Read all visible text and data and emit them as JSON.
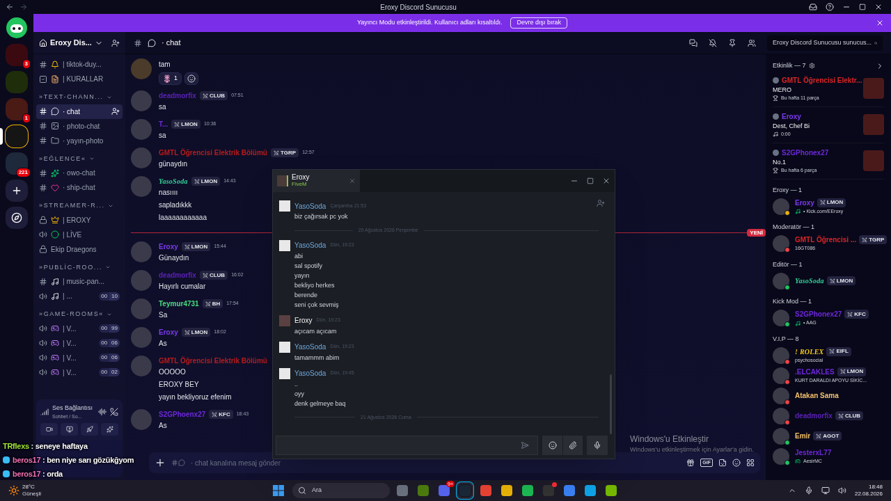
{
  "window": {
    "title": "Eroxy Discord Sunucusu"
  },
  "banner": {
    "text": "Yayıncı Modu etkinleştirildi. Kullanıcı adları kısaltıldı.",
    "button": "Devre dışı bırak"
  },
  "servers": [
    {
      "kind": "server",
      "selected": false,
      "badge": "3"
    },
    {
      "kind": "server",
      "selected": false
    },
    {
      "kind": "server",
      "selected": false,
      "badge": "1"
    },
    {
      "kind": "server",
      "selected": true
    },
    {
      "kind": "folder",
      "selected": false,
      "badge": "221"
    },
    {
      "kind": "add",
      "selected": false
    },
    {
      "kind": "discover",
      "selected": false
    }
  ],
  "server": {
    "name": "Eroxy Dis..."
  },
  "channels": [
    {
      "kind": "text",
      "name": "| tiktok-duy...",
      "selected": false
    },
    {
      "kind": "rules",
      "name": "| KURALLAR",
      "selected": false
    },
    {
      "kind": "category",
      "name": "»TEXT-CHANN..."
    },
    {
      "kind": "text",
      "name": "· chat",
      "selected": true
    },
    {
      "kind": "text",
      "name": "· photo-chat",
      "selected": false
    },
    {
      "kind": "text",
      "name": "· yayın-photo",
      "selected": false
    },
    {
      "kind": "category",
      "name": "»EĞLENCE«"
    },
    {
      "kind": "text",
      "name": "· owo-chat",
      "selected": false
    },
    {
      "kind": "text",
      "name": "· ship-chat",
      "selected": false
    },
    {
      "kind": "category",
      "name": "»STREAMER-R..."
    },
    {
      "kind": "locked",
      "name": "| EROXY",
      "selected": false
    },
    {
      "kind": "voice",
      "name": "| LİVE",
      "selected": false
    },
    {
      "kind": "locked",
      "name": "Ekip Draegons",
      "selected": false
    },
    {
      "kind": "category",
      "name": "»PUBLİC-ROO..."
    },
    {
      "kind": "text",
      "name": "| music-pan...",
      "selected": false
    },
    {
      "kind": "voice",
      "name": "| ...",
      "selected": false,
      "users": "00",
      "limit": "10"
    },
    {
      "kind": "category",
      "name": "»GAME-ROOMS«"
    },
    {
      "kind": "voice",
      "name": "| V...",
      "selected": false,
      "users": "00",
      "limit": "99"
    },
    {
      "kind": "voice",
      "name": "| V...",
      "selected": false,
      "users": "00",
      "limit": "06"
    },
    {
      "kind": "voice",
      "name": "| V...",
      "selected": false,
      "users": "00",
      "limit": "06"
    },
    {
      "kind": "voice",
      "name": "| V...",
      "selected": false,
      "users": "00",
      "limit": "02"
    }
  ],
  "voice": {
    "title": "Ses Bağlantısı",
    "subtitle": "Sohbet / So..."
  },
  "header": {
    "channel": "· chat",
    "search": "Eroxy Discord Sunucusu sunucus..."
  },
  "messages": [
    {
      "kind": "continuation",
      "lines": [
        "tam"
      ],
      "reactions": [
        {
          "count": "1"
        }
      ]
    },
    {
      "kind": "message",
      "author": "deadmorfix",
      "color": "#5b21b6",
      "decorated": false,
      "tag": "CLUB",
      "time": "07:51",
      "lines": [
        "sa"
      ]
    },
    {
      "kind": "message",
      "author": "T...",
      "color": "#6d28d9",
      "decorated": false,
      "tag": "LMON",
      "time": "10:36",
      "lines": [
        "sa"
      ]
    },
    {
      "kind": "message",
      "author": "GMTL Öğrencisi Elektrik Bölümü",
      "color": "#b91c1c",
      "decorated": false,
      "tag": "TGRP",
      "time": "12:57",
      "lines": [
        "günaydın"
      ]
    },
    {
      "kind": "message",
      "author": "YasoSoda",
      "color": "#34d399",
      "decorated": true,
      "tag": "LMON",
      "time": "14:43",
      "lines": [
        "nasıııı",
        "sapladıkkk",
        "laaaaaaaaaaaa"
      ]
    },
    {
      "kind": "divider",
      "label": "YENİ"
    },
    {
      "kind": "message",
      "author": "Eroxy",
      "color": "#7c3aed",
      "decorated": false,
      "tag": "LMON",
      "time": "15:44",
      "lines": [
        "Günaydın"
      ]
    },
    {
      "kind": "message",
      "author": "deadmorfix",
      "color": "#5b21b6",
      "decorated": false,
      "tag": "CLUB",
      "time": "16:02",
      "lines": [
        "Hayırlı cumalar"
      ]
    },
    {
      "kind": "message",
      "author": "Teymur4731",
      "color": "#4ade80",
      "decorated": false,
      "tag": "BH",
      "time": "17:54",
      "lines": [
        "Sa"
      ]
    },
    {
      "kind": "message",
      "author": "Eroxy",
      "color": "#7c3aed",
      "decorated": false,
      "tag": "LMON",
      "time": "18:02",
      "lines": [
        "As"
      ]
    },
    {
      "kind": "message",
      "author": "GMTL Öğrencisi Elektrik Bölümü",
      "color": "#b91c1c",
      "decorated": false,
      "lines": [
        "OOOOO",
        "EROXY BEY",
        "yayın bekliyoruz efenim"
      ]
    },
    {
      "kind": "message",
      "author": "S2GPhoenx27",
      "color": "#6d28d9",
      "decorated": false,
      "tag": "KFC",
      "time": "18:43",
      "lines": [
        "As"
      ]
    }
  ],
  "composer": {
    "placeholder": "· chat kanalına mesaj gönder",
    "gif": "GIF"
  },
  "activity": {
    "title": "Etkinlik — 7",
    "cards": [
      {
        "name": "GMTL Öğrencisi Elektr...",
        "color": "#dc2626",
        "title": "MERO",
        "detail": "Bu hafta 11 parça",
        "kind": "trophy"
      },
      {
        "name": "Eroxy",
        "color": "#7c3aed",
        "title": "Dest, Chef Bi",
        "detail": "0:00",
        "kind": "music"
      },
      {
        "name": "S2GPhonex27",
        "color": "#6d28d9",
        "title": "No.1",
        "detail": "Bu hafta 6 parça",
        "kind": "trophy"
      }
    ]
  },
  "member_groups": [
    {
      "title": "Eroxy — 1",
      "members": [
        {
          "name": "Eroxy",
          "color": "#7c3aed",
          "decorated": false,
          "tag": "LMON",
          "activity": {
            "kind": "music",
            "text": "• Kick.com/EEroxy"
          },
          "status": {
            "color": "#eab308"
          }
        }
      ]
    },
    {
      "title": "Moderatör — 1",
      "members": [
        {
          "name": "GMTL Öğrencisi ...",
          "color": "#dc2626",
          "decorated": false,
          "tag": "TGRP",
          "activity": {
            "kind": "plain",
            "text": "16GT086"
          },
          "status": {
            "color": "#ef4444"
          }
        }
      ]
    },
    {
      "title": "Editör — 1",
      "members": [
        {
          "name": "YasoSoda",
          "color": "#34d399",
          "decorated": true,
          "tag": "LMON",
          "status": {
            "color": "#22c55e"
          }
        }
      ]
    },
    {
      "title": "Kick Mod — 1",
      "members": [
        {
          "name": "S2GPhonex27",
          "color": "#6d28d9",
          "decorated": false,
          "tag": "KFC",
          "activity": {
            "kind": "music",
            "text": "• AAG"
          },
          "status": {
            "color": "#22c55e"
          }
        }
      ]
    },
    {
      "title": "V.I.P — 8",
      "members": [
        {
          "name": "! ROLEX",
          "color": "#facc15",
          "decorated": true,
          "tag": "EIFL",
          "activity": {
            "kind": "plain",
            "text": "psychosocial"
          },
          "status": {
            "color": "#ef4444"
          }
        },
        {
          "name": ".ELCAKLES",
          "color": "#6d28d9",
          "decorated": false,
          "tag": "LMON",
          "activity": {
            "kind": "plain",
            "text": "KURT DARALDI APOYU SİKİC..."
          },
          "status": {
            "color": "#ef4444"
          }
        },
        {
          "name": "Atakan Sama",
          "color": "#f5c26b",
          "decorated": false,
          "status": {
            "color": "#ef4444"
          }
        },
        {
          "name": "deadmorfix",
          "color": "#5b21b6",
          "decorated": false,
          "tag": "CLUB",
          "status": {
            "color": "#ef4444"
          }
        },
        {
          "name": "Emir",
          "color": "#f5c26b",
          "decorated": false,
          "tag": "AGOT",
          "status": {
            "color": "#22c55e"
          }
        },
        {
          "name": "JesterxL77",
          "color": "#6d28d9",
          "decorated": false,
          "activity": {
            "kind": "game",
            "text": "AesirMC"
          },
          "status": {
            "color": "#22c55e"
          }
        }
      ]
    }
  ],
  "steam_chat": {
    "tab": {
      "name": "Eroxy",
      "status": "FiveM"
    },
    "messages": [
      {
        "kind": "message",
        "author": "YasoSoda",
        "self": false,
        "time": "Çarşamba 21:53",
        "lines": [
          "biz çağırsak pc yok"
        ]
      },
      {
        "kind": "date",
        "label": "20 Ağustos 2026 Perşembe"
      },
      {
        "kind": "message",
        "author": "YasoSoda",
        "self": false,
        "time": "Dün, 19:23",
        "lines": [
          "abi",
          "sal spotify",
          "yayın",
          "bekliyo herkes",
          "berende",
          "seni çok sevmiş"
        ]
      },
      {
        "kind": "message",
        "author": "Eroxy",
        "self": true,
        "time": "Dün, 19:23",
        "lines": [
          "açıcam açıcam"
        ]
      },
      {
        "kind": "message",
        "author": "YasoSoda",
        "self": false,
        "time": "Dün, 19:23",
        "lines": [
          "tamammm abim"
        ]
      },
      {
        "kind": "message",
        "author": "YasoSoda",
        "self": false,
        "time": "Dün, 19:45",
        "lines": [
          "..",
          "oyy",
          "denk gelmeye baq"
        ]
      },
      {
        "kind": "date",
        "label": "21 Ağustos 2026 Cuma"
      }
    ]
  },
  "stream_chat": [
    {
      "user": "TRflexs",
      "color": "#a3e635",
      "text": ": seneye haftaya",
      "badge": false
    },
    {
      "user": "beros17",
      "color": "#f472b6",
      "text": ": ben niye sarı gözükğyom",
      "badge": true
    },
    {
      "user": "beros17",
      "color": "#f472b6",
      "text": ": orda",
      "badge": true
    }
  ],
  "activation": {
    "title": "Windows'u Etkinleştir",
    "text": "Windows'u etkinleştirmek için Ayarlar'a gidin."
  },
  "taskbar": {
    "temp": "28°C",
    "weather": "Güneşli",
    "search": "Ara",
    "apps": [
      {
        "selected": false
      },
      {
        "selected": false
      },
      {
        "selected": false,
        "badge": "9+"
      },
      {
        "selected": true
      },
      {
        "selected": false
      },
      {
        "selected": false
      },
      {
        "selected": false
      },
      {
        "selected": false,
        "alert": true
      },
      {
        "selected": false
      },
      {
        "selected": false
      },
      {
        "selected": false
      }
    ],
    "time": "18:48",
    "date": "22.08.2026"
  }
}
